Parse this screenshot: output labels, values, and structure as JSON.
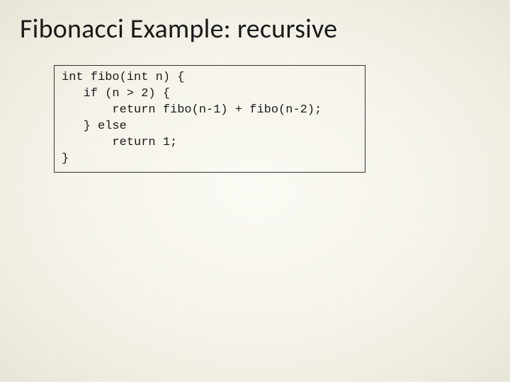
{
  "slide": {
    "title": "Fibonacci Example: recursive",
    "code": "int fibo(int n) {\n   if (n > 2) {\n       return fibo(n-1) + fibo(n-2);\n   } else\n       return 1;\n}"
  }
}
